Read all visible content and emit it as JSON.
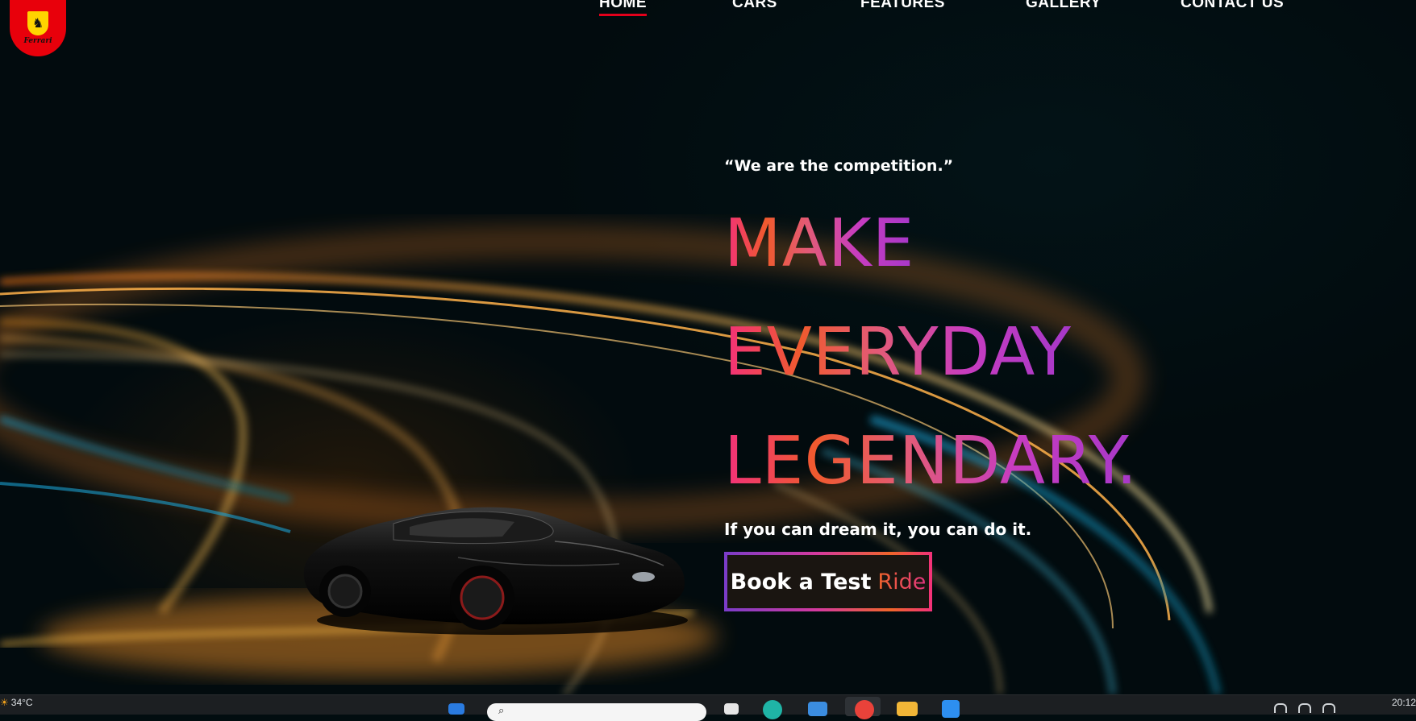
{
  "brand": {
    "logo_text": "Ferrari"
  },
  "nav": {
    "items": [
      {
        "label": "HOME",
        "active": true
      },
      {
        "label": "CARS",
        "active": false
      },
      {
        "label": "FEATURES",
        "active": false
      },
      {
        "label": "GALLERY",
        "active": false
      },
      {
        "label": "CONTACT US",
        "active": false
      }
    ]
  },
  "hero": {
    "quote": "“We are the competition.”",
    "headline": [
      "MAKE",
      "EVERYDAY",
      "LEGENDARY."
    ],
    "subline": "If you can dream it, you can do it.",
    "cta": {
      "main": "Book a Test",
      "accent": "Ride"
    }
  },
  "taskbar": {
    "weather": "34°C",
    "clock": "20:12"
  },
  "colors": {
    "accent_red": "#e3001b",
    "logo_red": "#e8000b",
    "gradient_pink": "#f2317a",
    "gradient_orange": "#f05a2e",
    "gradient_purple": "#a638c9",
    "background": "#020b0e"
  }
}
